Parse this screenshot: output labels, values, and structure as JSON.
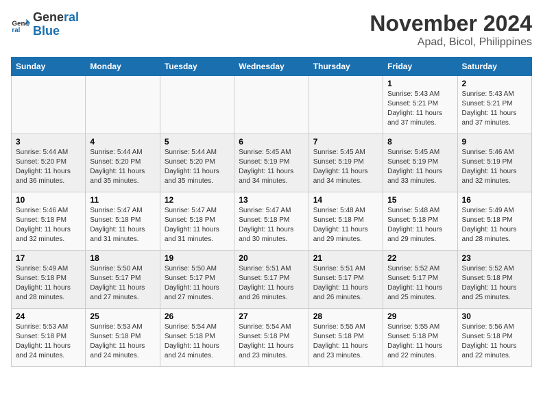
{
  "header": {
    "logo_line1": "General",
    "logo_line2": "Blue",
    "month_title": "November 2024",
    "location": "Apad, Bicol, Philippines"
  },
  "weekdays": [
    "Sunday",
    "Monday",
    "Tuesday",
    "Wednesday",
    "Thursday",
    "Friday",
    "Saturday"
  ],
  "weeks": [
    [
      {
        "day": "",
        "info": ""
      },
      {
        "day": "",
        "info": ""
      },
      {
        "day": "",
        "info": ""
      },
      {
        "day": "",
        "info": ""
      },
      {
        "day": "",
        "info": ""
      },
      {
        "day": "1",
        "info": "Sunrise: 5:43 AM\nSunset: 5:21 PM\nDaylight: 11 hours and 37 minutes."
      },
      {
        "day": "2",
        "info": "Sunrise: 5:43 AM\nSunset: 5:21 PM\nDaylight: 11 hours and 37 minutes."
      }
    ],
    [
      {
        "day": "3",
        "info": "Sunrise: 5:44 AM\nSunset: 5:20 PM\nDaylight: 11 hours and 36 minutes."
      },
      {
        "day": "4",
        "info": "Sunrise: 5:44 AM\nSunset: 5:20 PM\nDaylight: 11 hours and 35 minutes."
      },
      {
        "day": "5",
        "info": "Sunrise: 5:44 AM\nSunset: 5:20 PM\nDaylight: 11 hours and 35 minutes."
      },
      {
        "day": "6",
        "info": "Sunrise: 5:45 AM\nSunset: 5:19 PM\nDaylight: 11 hours and 34 minutes."
      },
      {
        "day": "7",
        "info": "Sunrise: 5:45 AM\nSunset: 5:19 PM\nDaylight: 11 hours and 34 minutes."
      },
      {
        "day": "8",
        "info": "Sunrise: 5:45 AM\nSunset: 5:19 PM\nDaylight: 11 hours and 33 minutes."
      },
      {
        "day": "9",
        "info": "Sunrise: 5:46 AM\nSunset: 5:19 PM\nDaylight: 11 hours and 32 minutes."
      }
    ],
    [
      {
        "day": "10",
        "info": "Sunrise: 5:46 AM\nSunset: 5:18 PM\nDaylight: 11 hours and 32 minutes."
      },
      {
        "day": "11",
        "info": "Sunrise: 5:47 AM\nSunset: 5:18 PM\nDaylight: 11 hours and 31 minutes."
      },
      {
        "day": "12",
        "info": "Sunrise: 5:47 AM\nSunset: 5:18 PM\nDaylight: 11 hours and 31 minutes."
      },
      {
        "day": "13",
        "info": "Sunrise: 5:47 AM\nSunset: 5:18 PM\nDaylight: 11 hours and 30 minutes."
      },
      {
        "day": "14",
        "info": "Sunrise: 5:48 AM\nSunset: 5:18 PM\nDaylight: 11 hours and 29 minutes."
      },
      {
        "day": "15",
        "info": "Sunrise: 5:48 AM\nSunset: 5:18 PM\nDaylight: 11 hours and 29 minutes."
      },
      {
        "day": "16",
        "info": "Sunrise: 5:49 AM\nSunset: 5:18 PM\nDaylight: 11 hours and 28 minutes."
      }
    ],
    [
      {
        "day": "17",
        "info": "Sunrise: 5:49 AM\nSunset: 5:18 PM\nDaylight: 11 hours and 28 minutes."
      },
      {
        "day": "18",
        "info": "Sunrise: 5:50 AM\nSunset: 5:17 PM\nDaylight: 11 hours and 27 minutes."
      },
      {
        "day": "19",
        "info": "Sunrise: 5:50 AM\nSunset: 5:17 PM\nDaylight: 11 hours and 27 minutes."
      },
      {
        "day": "20",
        "info": "Sunrise: 5:51 AM\nSunset: 5:17 PM\nDaylight: 11 hours and 26 minutes."
      },
      {
        "day": "21",
        "info": "Sunrise: 5:51 AM\nSunset: 5:17 PM\nDaylight: 11 hours and 26 minutes."
      },
      {
        "day": "22",
        "info": "Sunrise: 5:52 AM\nSunset: 5:17 PM\nDaylight: 11 hours and 25 minutes."
      },
      {
        "day": "23",
        "info": "Sunrise: 5:52 AM\nSunset: 5:18 PM\nDaylight: 11 hours and 25 minutes."
      }
    ],
    [
      {
        "day": "24",
        "info": "Sunrise: 5:53 AM\nSunset: 5:18 PM\nDaylight: 11 hours and 24 minutes."
      },
      {
        "day": "25",
        "info": "Sunrise: 5:53 AM\nSunset: 5:18 PM\nDaylight: 11 hours and 24 minutes."
      },
      {
        "day": "26",
        "info": "Sunrise: 5:54 AM\nSunset: 5:18 PM\nDaylight: 11 hours and 24 minutes."
      },
      {
        "day": "27",
        "info": "Sunrise: 5:54 AM\nSunset: 5:18 PM\nDaylight: 11 hours and 23 minutes."
      },
      {
        "day": "28",
        "info": "Sunrise: 5:55 AM\nSunset: 5:18 PM\nDaylight: 11 hours and 23 minutes."
      },
      {
        "day": "29",
        "info": "Sunrise: 5:55 AM\nSunset: 5:18 PM\nDaylight: 11 hours and 22 minutes."
      },
      {
        "day": "30",
        "info": "Sunrise: 5:56 AM\nSunset: 5:18 PM\nDaylight: 11 hours and 22 minutes."
      }
    ]
  ]
}
